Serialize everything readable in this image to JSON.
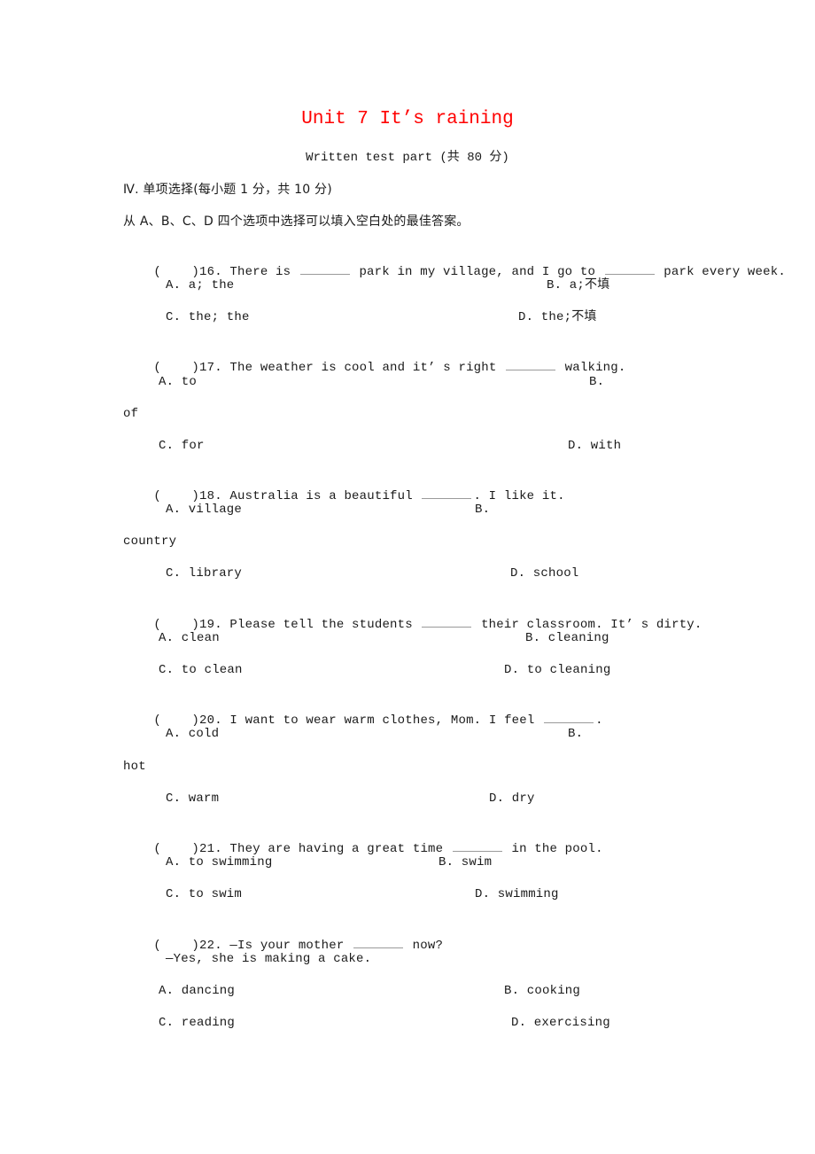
{
  "header": {
    "title": "Unit 7 It’s raining",
    "subtitle": "Written test part (共 80 分)",
    "title_color": "#ff0000"
  },
  "section": {
    "heading": "Ⅳ. 单项选择(每小题 1 分，共 10 分)",
    "instruction": "从 A、B、C、D 四个选项中选择可以填入空白处的最佳答案。"
  },
  "questions": [
    {
      "number": "16",
      "bracket": "(    )",
      "stem_parts": [
        "16. There is ",
        " park in my village, and I go to ",
        " park every week."
      ],
      "options": {
        "A": "A. a; the",
        "B": "B. a;不填",
        "C": "C. the; the",
        "D": "D. the;不填"
      }
    },
    {
      "number": "17",
      "bracket": "(    )",
      "stem_parts": [
        "17. The weather is cool and it’ s right ",
        " walking."
      ],
      "options": {
        "A": "A. to",
        "B": "B.",
        "B_wrap": "of",
        "C": "C. for",
        "D": "D. with"
      }
    },
    {
      "number": "18",
      "bracket": "(    )",
      "stem_parts": [
        "18. Australia is a beautiful ",
        ". I like it."
      ],
      "options": {
        "A": "A. village",
        "B": "B.",
        "B_wrap": "country",
        "C": "C. library",
        "D": "D. school"
      }
    },
    {
      "number": "19",
      "bracket": "(    )",
      "stem_parts": [
        "19. Please tell the students ",
        " their classroom. It’ s dirty."
      ],
      "options": {
        "A": "A. clean",
        "B": "B. cleaning",
        "C": "C. to clean",
        "D": "D. to cleaning"
      }
    },
    {
      "number": "20",
      "bracket": "(    )",
      "stem_parts": [
        "20. I want to wear warm clothes, Mom. I feel ",
        "."
      ],
      "options": {
        "A": "A. cold",
        "B": "B.",
        "B_wrap": "hot",
        "C": "C. warm",
        "D": "D. dry"
      }
    },
    {
      "number": "21",
      "bracket": "(    )",
      "stem_parts": [
        "21. They are having a great time ",
        " in the pool."
      ],
      "options": {
        "A": "A. to swimming",
        "B": "B. swim",
        "C": "C. to swim",
        "D": "D. swimming"
      }
    },
    {
      "number": "22",
      "bracket": "(    )",
      "stem_parts": [
        "22. —Is your mother ",
        " now?"
      ],
      "reply": "—Yes, she is making a cake.",
      "options": {
        "A": "A. dancing",
        "B": "B. cooking",
        "C": "C. reading",
        "D": "D. exercising"
      }
    }
  ]
}
